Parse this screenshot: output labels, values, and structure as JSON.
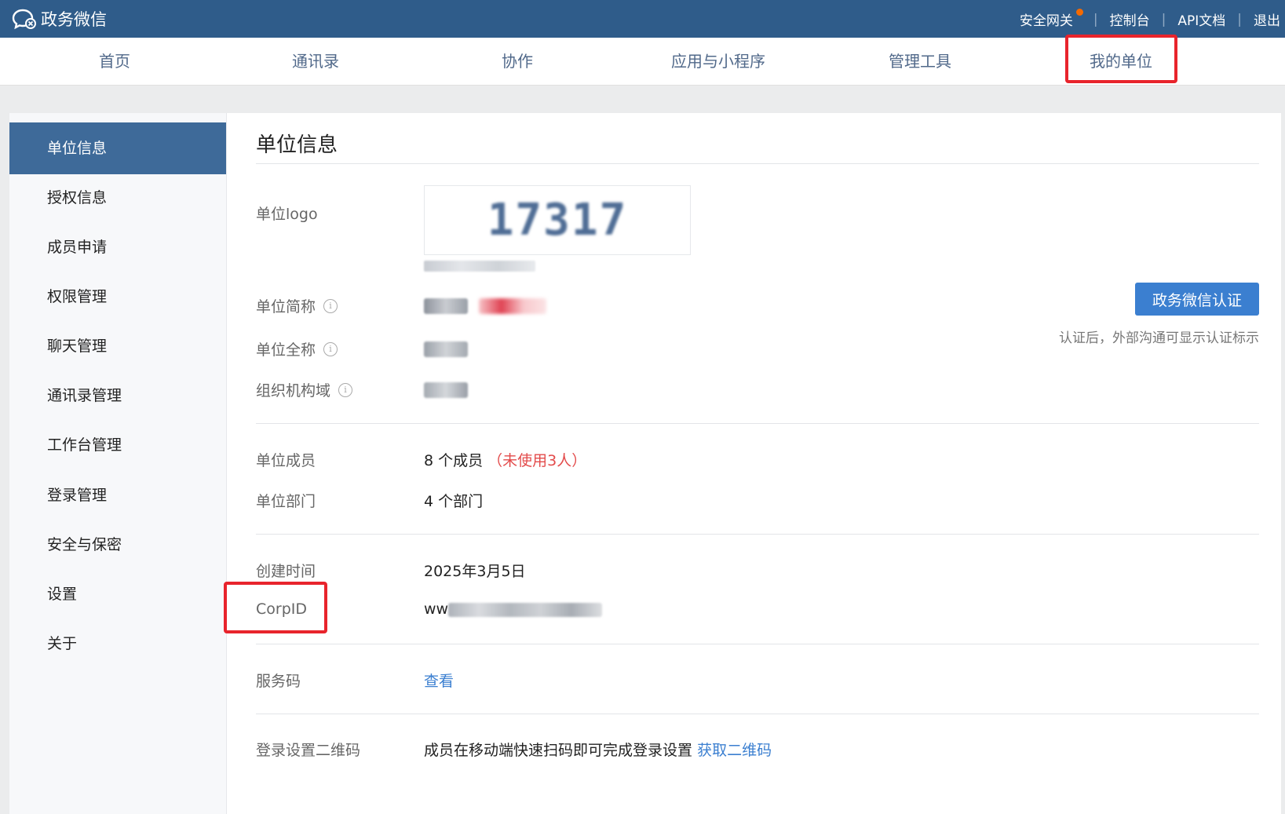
{
  "brand": {
    "name": "政务微信"
  },
  "top_links": [
    {
      "label": "安全网关"
    },
    {
      "label": "控制台"
    },
    {
      "label": "API文档"
    },
    {
      "label": "退出"
    }
  ],
  "nav": [
    {
      "label": "首页"
    },
    {
      "label": "通讯录"
    },
    {
      "label": "协作"
    },
    {
      "label": "应用与小程序"
    },
    {
      "label": "管理工具"
    },
    {
      "label": "我的单位"
    }
  ],
  "sidebar": [
    {
      "label": "单位信息",
      "active": true
    },
    {
      "label": "授权信息"
    },
    {
      "label": "成员申请"
    },
    {
      "label": "权限管理"
    },
    {
      "label": "聊天管理"
    },
    {
      "label": "通讯录管理"
    },
    {
      "label": "工作台管理"
    },
    {
      "label": "登录管理"
    },
    {
      "label": "安全与保密"
    },
    {
      "label": "设置"
    },
    {
      "label": "关于"
    }
  ],
  "content": {
    "title": "单位信息",
    "logo_label": "单位logo",
    "logo_text": "17317",
    "short_name_label": "单位简称",
    "full_name_label": "单位全称",
    "org_domain_label": "组织机构域",
    "cert_button": "政务微信认证",
    "cert_note": "认证后，外部沟通可显示认证标示",
    "members_label": "单位成员",
    "members_value": "8 个成员",
    "members_unused": "（未使用3人）",
    "depts_label": "单位部门",
    "depts_value": "4 个部门",
    "created_label": "创建时间",
    "created_value": "2025年3月5日",
    "corpid_label": "CorpID",
    "corpid_prefix": "ww",
    "service_code_label": "服务码",
    "service_code_link": "查看",
    "qr_label": "登录设置二维码",
    "qr_text": "成员在移动端快速扫码即可完成登录设置",
    "qr_link": "获取二维码"
  },
  "colors": {
    "topbar": "#2f5c8a",
    "nav_text": "#51698a",
    "sidebar_active": "#3e6a99",
    "button": "#3b7fd0",
    "highlight": "#e8242c",
    "warning": "#e34b4b"
  }
}
